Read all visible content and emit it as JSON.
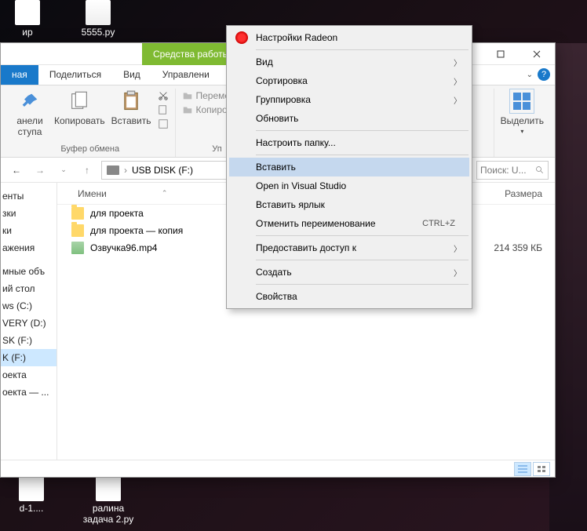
{
  "desktop": {
    "top_icons": [
      {
        "label": "ир"
      },
      {
        "label": "5555.py"
      }
    ],
    "bottom_icons": [
      {
        "label": "d-1...."
      },
      {
        "label_line1": "ралина",
        "label_line2": "задача 2.ру"
      }
    ]
  },
  "explorer": {
    "titlebar_tools": "Средства работы с",
    "tabs": {
      "file": "ная",
      "share": "Поделиться",
      "view": "Вид",
      "manage": "Управлени"
    },
    "ribbon": {
      "panels": "анели\nступа",
      "copy": "Копировать",
      "paste": "Вставить",
      "clipboard_label": "Буфер обмена",
      "move": "Переместит",
      "copy2": "Копироват",
      "organize_label": "Уп",
      "select": "Выделить"
    },
    "address": {
      "path": "USB DISK (F:)"
    },
    "search": {
      "placeholder": "Поиск: U..."
    },
    "nav_items": [
      "енты",
      "зки",
      "ки",
      "ажения",
      "",
      "мные объ",
      "ий стол",
      "ws (C:)",
      "VERY (D:)",
      "SK (F:)",
      "K (F:)",
      "оекта",
      "оекта — ..."
    ],
    "nav_selected_index": 10,
    "columns": {
      "name": "Имени",
      "size": "Размера"
    },
    "files": [
      {
        "icon": "folder",
        "name": "для проекта",
        "size": ""
      },
      {
        "icon": "folder",
        "name": "для проекта — копия",
        "size": ""
      },
      {
        "icon": "video",
        "name": "Озвучка96.mp4",
        "size": "214 359 КБ"
      }
    ]
  },
  "context_menu": {
    "radeon": "Настройки Radeon",
    "view": "Вид",
    "sort": "Сортировка",
    "group": "Группировка",
    "refresh": "Обновить",
    "customize": "Настроить папку...",
    "paste": "Вставить",
    "open_vs": "Open in Visual Studio",
    "paste_shortcut": "Вставить ярлык",
    "undo_rename": "Отменить переименование",
    "undo_key": "CTRL+Z",
    "share_access": "Предоставить доступ к",
    "create": "Создать",
    "properties": "Свойства"
  }
}
